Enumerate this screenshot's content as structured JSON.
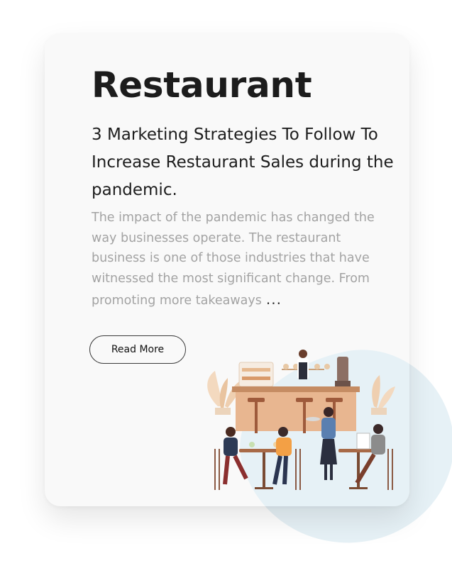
{
  "card": {
    "category": "Restaurant",
    "headline": "3 Marketing Strategies To Follow To Increase Restaurant Sales during the pandemic.",
    "excerpt": "The impact of the pandemic has changed the way businesses operate. The restaurant business is one of those industries that have witnessed the most significant change. From promoting more takeaways",
    "ellipsis": "...",
    "read_more_label": "Read More"
  },
  "colors": {
    "title": "#1c1c1c",
    "excerpt": "#a3a3a3",
    "blob": "#e6f1f6",
    "card": "#f9f9f9"
  },
  "icons": [
    "restaurant-illustration"
  ]
}
